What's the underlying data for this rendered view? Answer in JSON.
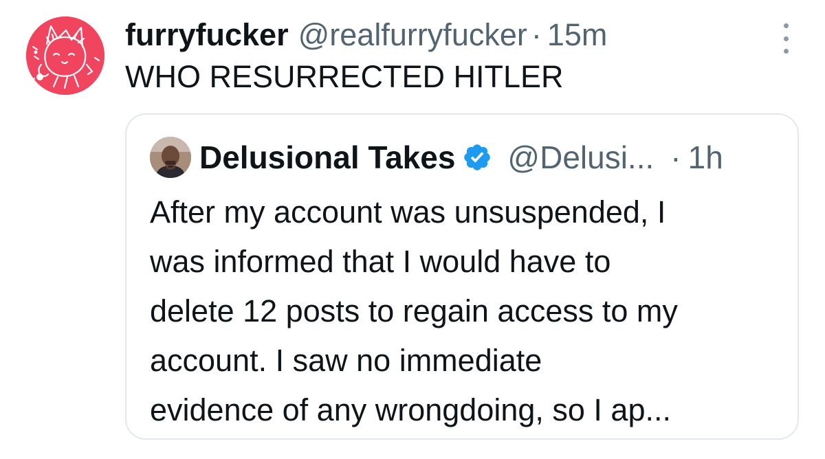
{
  "tweet": {
    "avatar_icon": "furry-character-avatar",
    "display_name": "furryfucker",
    "handle": "@realfurryfucker",
    "separator": "·",
    "time": "15m",
    "text": "WHO RESURRECTED HITLER",
    "more_icon": "more-vertical-icon"
  },
  "quote": {
    "avatar_icon": "man-avatar",
    "display_name": "Delusional Takes",
    "verified_icon": "verified-badge-icon",
    "handle": "@Delusi...",
    "separator": "·",
    "time": "1h",
    "lines": [
      "After my account was unsuspended, I",
      "was informed that I would have to",
      "delete 12 posts to regain access to my",
      "account. I saw no immediate",
      "evidence of any wrongdoing, so I ap..."
    ]
  },
  "colors": {
    "text": "#0f1419",
    "secondary": "#536471",
    "verified": "#1d9bf0",
    "avatar_bg": "#f1455f",
    "border": "#e3e8ec"
  }
}
